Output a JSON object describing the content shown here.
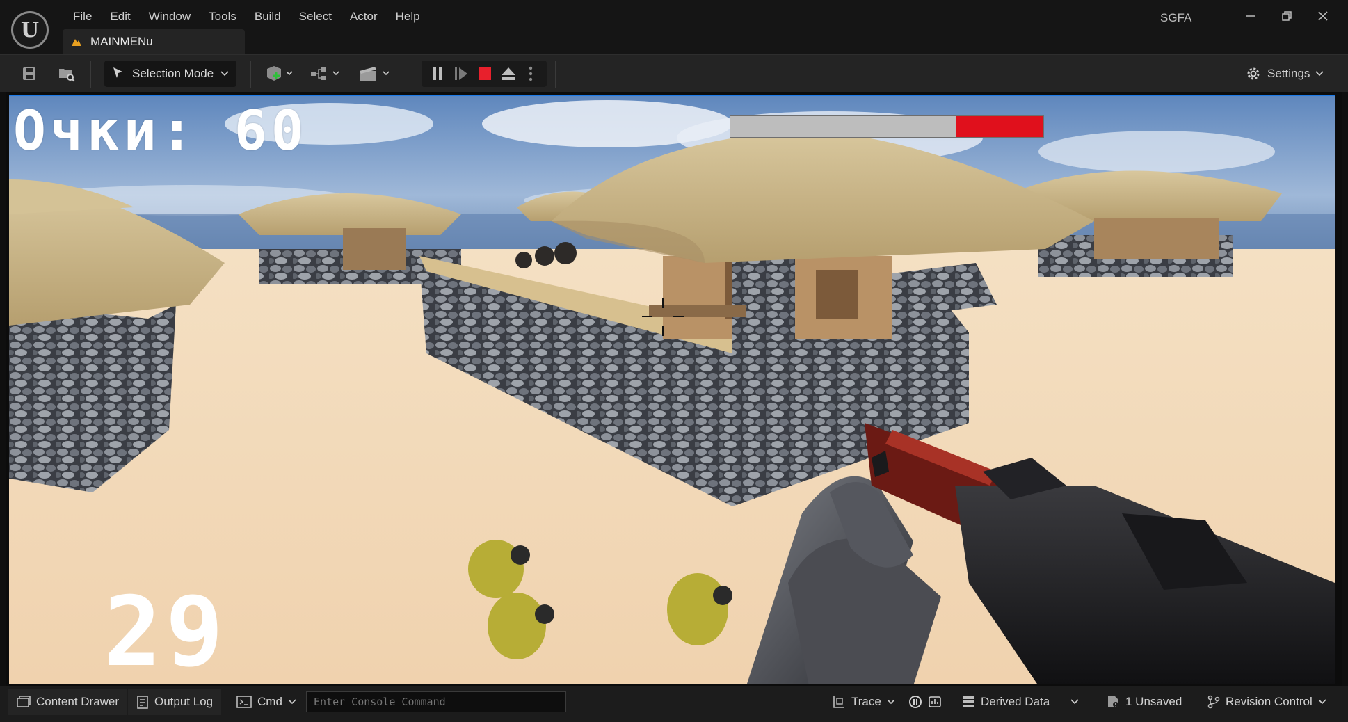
{
  "window": {
    "project_name": "SGFA",
    "tab_label": "MAINMENu",
    "controls": [
      "minimize",
      "restore",
      "close"
    ]
  },
  "menu": [
    "File",
    "Edit",
    "Window",
    "Tools",
    "Build",
    "Select",
    "Actor",
    "Help"
  ],
  "toolbar": {
    "selection_mode_label": "Selection Mode",
    "settings_label": "Settings",
    "icons": [
      "save-icon",
      "browse-icon",
      "add-actor-icon",
      "blueprint-icon",
      "cinematics-icon",
      "pause-icon",
      "step-icon",
      "stop-icon",
      "eject-icon",
      "more-icon",
      "gear-icon"
    ]
  },
  "hud": {
    "score_text": "Очки: 60",
    "ammo_text": "29",
    "health_fraction": 0.28,
    "health_color": "#e0101c"
  },
  "statusbar": {
    "content_drawer_label": "Content Drawer",
    "output_log_label": "Output Log",
    "cmd_label": "Cmd",
    "console_placeholder": "Enter Console Command",
    "trace_label": "Trace",
    "derived_data_label": "Derived Data",
    "unsaved_label": "1 Unsaved",
    "revision_control_label": "Revision Control"
  },
  "colors": {
    "accent_blue": "#1e7ae6",
    "stop_red": "#e8202c",
    "sand": "#f1d9b8",
    "sky": "#6f95c4",
    "thatch": "#c9b68c"
  }
}
